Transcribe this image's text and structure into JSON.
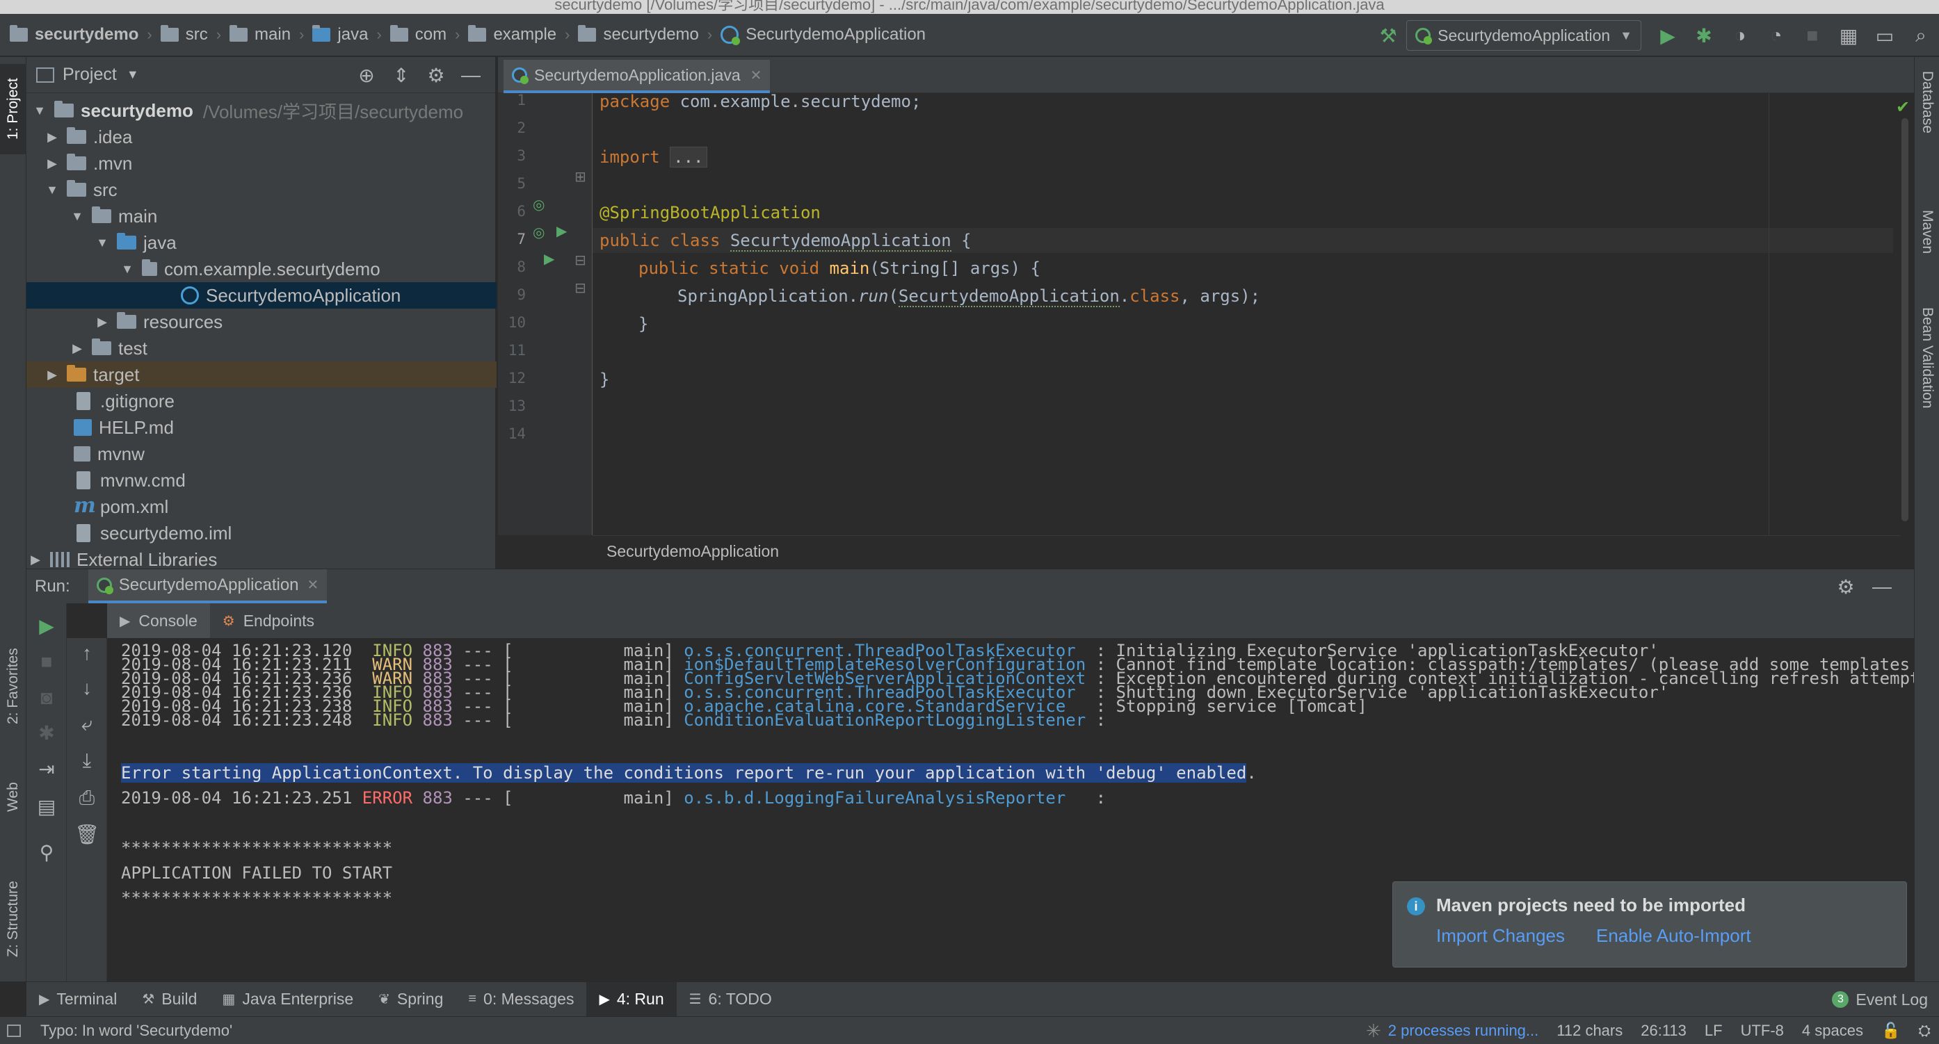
{
  "window": {
    "title": "securtydemo [/Volumes/学习项目/securtydemo] - .../src/main/java/com/example/securtydemo/SecurtydemoApplication.java"
  },
  "navbar": {
    "breadcrumbs": [
      "securtydemo",
      "src",
      "main",
      "java",
      "com",
      "example",
      "securtydemo",
      "SecurtydemoApplication"
    ],
    "run_config": "SecurtydemoApplication"
  },
  "left_strip": {
    "project": "1: Project",
    "favorites": "2: Favorites",
    "web": "Web",
    "structure": "Z: Structure"
  },
  "right_strip": {
    "database": "Database",
    "maven": "Maven",
    "bean_validation": "Bean Validation"
  },
  "project": {
    "header": "Project",
    "tree": [
      {
        "label": "securtydemo",
        "path": "/Volumes/学习项目/securtydemo"
      },
      {
        "label": ".idea"
      },
      {
        "label": ".mvn"
      },
      {
        "label": "src"
      },
      {
        "label": "main"
      },
      {
        "label": "java"
      },
      {
        "label": "com.example.securtydemo"
      },
      {
        "label": "SecurtydemoApplication"
      },
      {
        "label": "resources"
      },
      {
        "label": "test"
      },
      {
        "label": "target"
      },
      {
        "label": ".gitignore"
      },
      {
        "label": "HELP.md"
      },
      {
        "label": "mvnw"
      },
      {
        "label": "mvnw.cmd"
      },
      {
        "label": "pom.xml"
      },
      {
        "label": "securtydemo.iml"
      },
      {
        "label": "External Libraries"
      }
    ]
  },
  "editor": {
    "tab": "SecurtydemoApplication.java",
    "line_numbers": [
      "1",
      "2",
      "3",
      "5",
      "6",
      "7",
      "8",
      "9",
      "10",
      "11",
      "12",
      "13",
      "14"
    ],
    "code": {
      "l1_kw": "package",
      "l1_rest": " com.example.securtydemo;",
      "l3_kw": "import",
      "l3_fold": "...",
      "l6": "@SpringBootApplication",
      "l7_kw": "public class",
      "l7_cls": "SecurtydemoApplication",
      "l7_rest": " {",
      "l9_kw": "public static void",
      "l9_fn": "main",
      "l9_rest": "(String[] args) {",
      "l10_a": "SpringApplication.",
      "l10_run": "run",
      "l10_b": "(",
      "l10_cls": "SecurtydemoApplication",
      "l10_c": ".",
      "l10_kw": "class",
      "l10_d": ", args);",
      "l11": "}",
      "l13": "}"
    },
    "breadcrumb": "SecurtydemoApplication"
  },
  "run": {
    "label": "Run:",
    "tab": "SecurtydemoApplication",
    "subtabs": {
      "console": "Console",
      "endpoints": "Endpoints"
    },
    "log": [
      {
        "ts": "2019-08-04 16:21:23.120",
        "level": "INFO",
        "pid": "883",
        "sep": "---",
        "thread": "[           main]",
        "logger": "o.s.s.concurrent.ThreadPoolTaskExecutor ",
        "msg": ": Initializing ExecutorService 'applicationTaskExecutor'"
      },
      {
        "ts": "2019-08-04 16:21:23.211",
        "level": "WARN",
        "pid": "883",
        "sep": "---",
        "thread": "[           main]",
        "logger": "ion$DefaultTemplateResolverConfiguration",
        "msg": ": Cannot find template location: classpath:/templates/ (please add some templates or che"
      },
      {
        "ts": "2019-08-04 16:21:23.236",
        "level": "WARN",
        "pid": "883",
        "sep": "---",
        "thread": "[           main]",
        "logger": "ConfigServletWebServerApplicationContext",
        "msg": ": Exception encountered during context initialization - cancelling refresh attempt: org"
      },
      {
        "ts": "2019-08-04 16:21:23.236",
        "level": "INFO",
        "pid": "883",
        "sep": "---",
        "thread": "[           main]",
        "logger": "o.s.s.concurrent.ThreadPoolTaskExecutor ",
        "msg": ": Shutting down ExecutorService 'applicationTaskExecutor'"
      },
      {
        "ts": "2019-08-04 16:21:23.238",
        "level": "INFO",
        "pid": "883",
        "sep": "---",
        "thread": "[           main]",
        "logger": "o.apache.catalina.core.StandardService  ",
        "msg": ": Stopping service [Tomcat]"
      },
      {
        "ts": "2019-08-04 16:21:23.248",
        "level": "INFO",
        "pid": "883",
        "sep": "---",
        "thread": "[           main]",
        "logger": "ConditionEvaluationReportLoggingListener",
        "msg": ":"
      }
    ],
    "error_highlight": "Error starting ApplicationContext. To display the conditions report re-run your application with 'debug' enabled",
    "error_tail": ".",
    "error_line": {
      "ts": "2019-08-04 16:21:23.251",
      "level": "ERROR",
      "pid": "883",
      "sep": "---",
      "thread": "[           main]",
      "logger": "o.s.b.d.LoggingFailureAnalysisReporter  ",
      "msg": ":"
    },
    "stars": "***************************",
    "failed": "APPLICATION FAILED TO START"
  },
  "notification": {
    "title": "Maven projects need to be imported",
    "import_changes": "Import Changes",
    "enable_auto_import": "Enable Auto-Import"
  },
  "bottom_tabs": [
    "Terminal",
    "Build",
    "Java Enterprise",
    "Spring",
    "0: Messages",
    "4: Run",
    "6: TODO"
  ],
  "event_log": {
    "label": "Event Log",
    "count": "3"
  },
  "status": {
    "message": "Typo: In word 'Securtydemo'",
    "processes": "2 processes running...",
    "chars": "112 chars",
    "position": "26:113",
    "line_sep": "LF",
    "encoding": "UTF-8",
    "indent": "4 spaces"
  },
  "colors": {
    "accent": "#4a88c7",
    "background": "#2b2b2b",
    "panel": "#3c3f41",
    "link": "#589df6",
    "selection": "#214283"
  }
}
